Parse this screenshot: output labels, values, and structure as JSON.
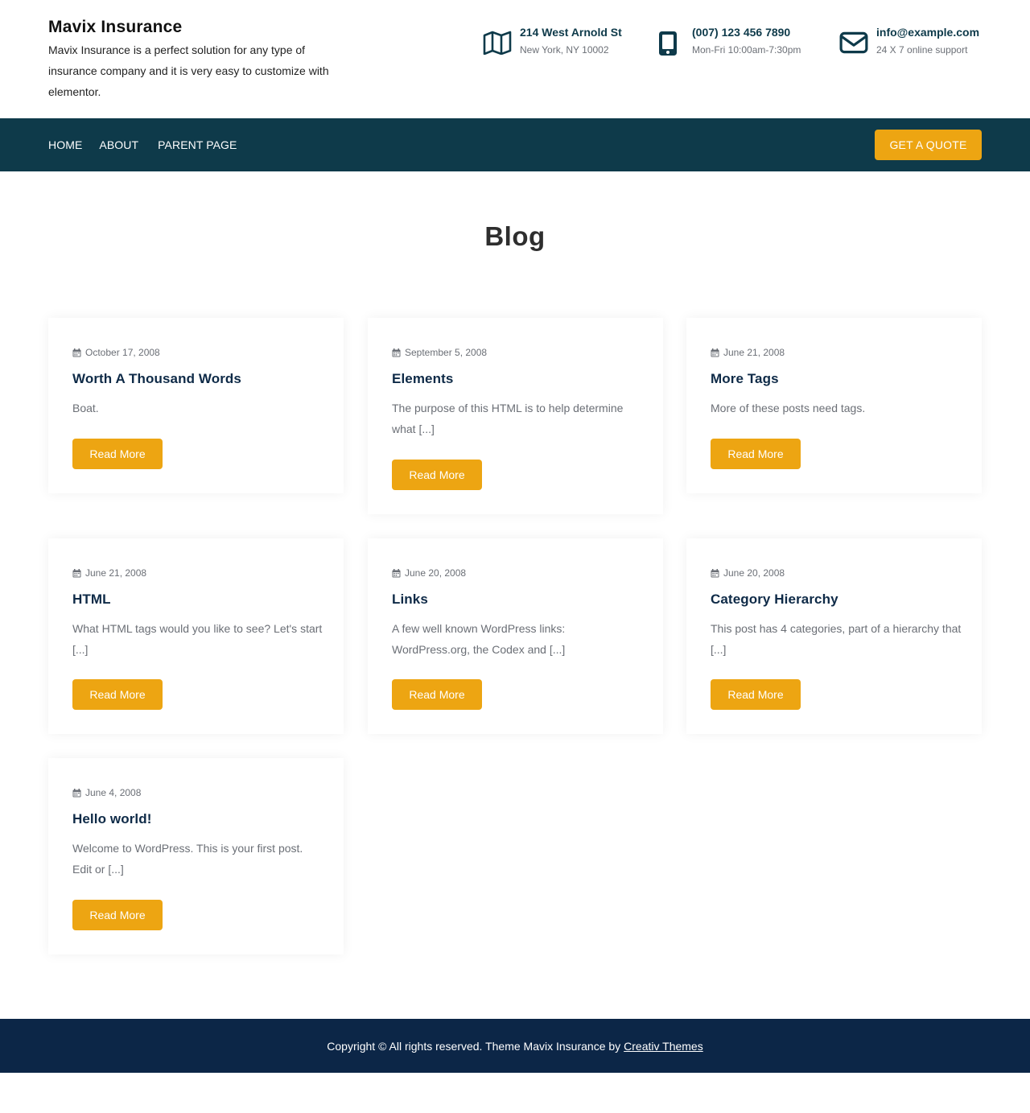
{
  "header": {
    "site_title": "Mavix Insurance",
    "site_description": "Mavix Insurance is a perfect solution for any type of insurance company and it is very easy to customize with elementor.",
    "contacts": [
      {
        "icon": "map-icon",
        "title": "214 West Arnold St",
        "subtitle": "New York, NY 10002"
      },
      {
        "icon": "phone-icon",
        "title": "(007) 123 456 7890",
        "subtitle": "Mon-Fri 10:00am-7:30pm"
      },
      {
        "icon": "envelope-icon",
        "title": "info@example.com",
        "subtitle": "24 X 7 online support"
      }
    ]
  },
  "nav": {
    "items": [
      "HOME",
      "ABOUT",
      "PARENT PAGE"
    ],
    "cta_label": "GET A QUOTE"
  },
  "page": {
    "title": "Blog"
  },
  "posts": [
    {
      "date": "October 17, 2008",
      "title": "Worth A Thousand Words",
      "excerpt": "Boat.",
      "button": "Read More"
    },
    {
      "date": "September 5, 2008",
      "title": "Elements",
      "excerpt": "The purpose of this HTML is to help determine what [...]",
      "button": "Read More"
    },
    {
      "date": "June 21, 2008",
      "title": "More Tags",
      "excerpt": "More of these posts need tags.",
      "button": "Read More"
    },
    {
      "date": "June 21, 2008",
      "title": "HTML",
      "excerpt": "What HTML tags would you like to see? Let's start [...]",
      "button": "Read More"
    },
    {
      "date": "June 20, 2008",
      "title": "Links",
      "excerpt": "A few well known WordPress links: WordPress.org, the Codex and [...]",
      "button": "Read More"
    },
    {
      "date": "June 20, 2008",
      "title": "Category Hierarchy",
      "excerpt": "This post has 4 categories, part of a hierarchy that [...]",
      "button": "Read More"
    },
    {
      "date": "June 4, 2008",
      "title": "Hello world!",
      "excerpt": "Welcome to WordPress. This is your first post. Edit or [...]",
      "button": "Read More"
    }
  ],
  "footer": {
    "copyright": "Copyright © All rights reserved. Theme Mavix Insurance by",
    "link_text": "Creativ Themes"
  },
  "colors": {
    "primary": "#0e3a4a",
    "accent": "#eda512",
    "footer_bg": "#0c2647",
    "heading": "#0e2a47",
    "muted": "#6b6f76"
  }
}
